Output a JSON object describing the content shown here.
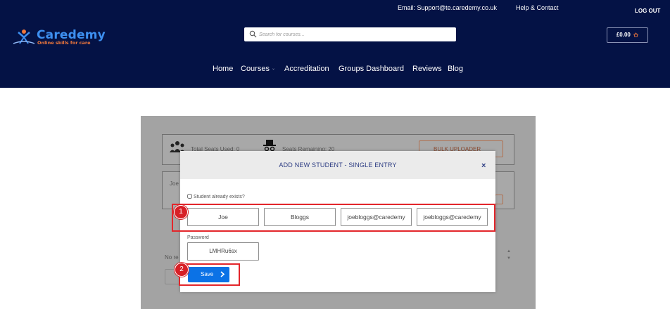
{
  "header": {
    "email": "Email: Support@te.caredemy.co.uk",
    "help": "Help & Contact",
    "logout": "LOG OUT",
    "logo_name": "Caredemy",
    "logo_tagline": "Online skills for care",
    "search_placeholder": "Search for courses...",
    "cart_amount": "£0.00",
    "nav": [
      "Home",
      "Courses",
      "Accreditation",
      "Groups Dashboard",
      "Reviews",
      "Blog"
    ]
  },
  "background": {
    "seats_used": "Total Seats Used: 0",
    "seats_remaining": "Seats Remaining: 20",
    "bulk_button": "BULK UPLOADER",
    "row_name": "Joe",
    "no_rows": "No re"
  },
  "modal": {
    "title": "ADD NEW STUDENT - SINGLE ENTRY",
    "close": "×",
    "exists_label": "Student already exists?",
    "first_name": "Joe",
    "last_name": "Bloggs",
    "email": "joebloggs@caredemy",
    "email_confirm": "joebloggs@caredemy",
    "password_label": "Password",
    "password": "LMHRu6sx",
    "save_label": "Save"
  },
  "annotations": [
    "1",
    "2"
  ],
  "colors": {
    "header_bg": "#041245",
    "accent_blue": "#0b72e6",
    "annotation_red": "#e3262b",
    "logo_blue": "#3d8ff0",
    "logo_orange": "#f0783c"
  }
}
